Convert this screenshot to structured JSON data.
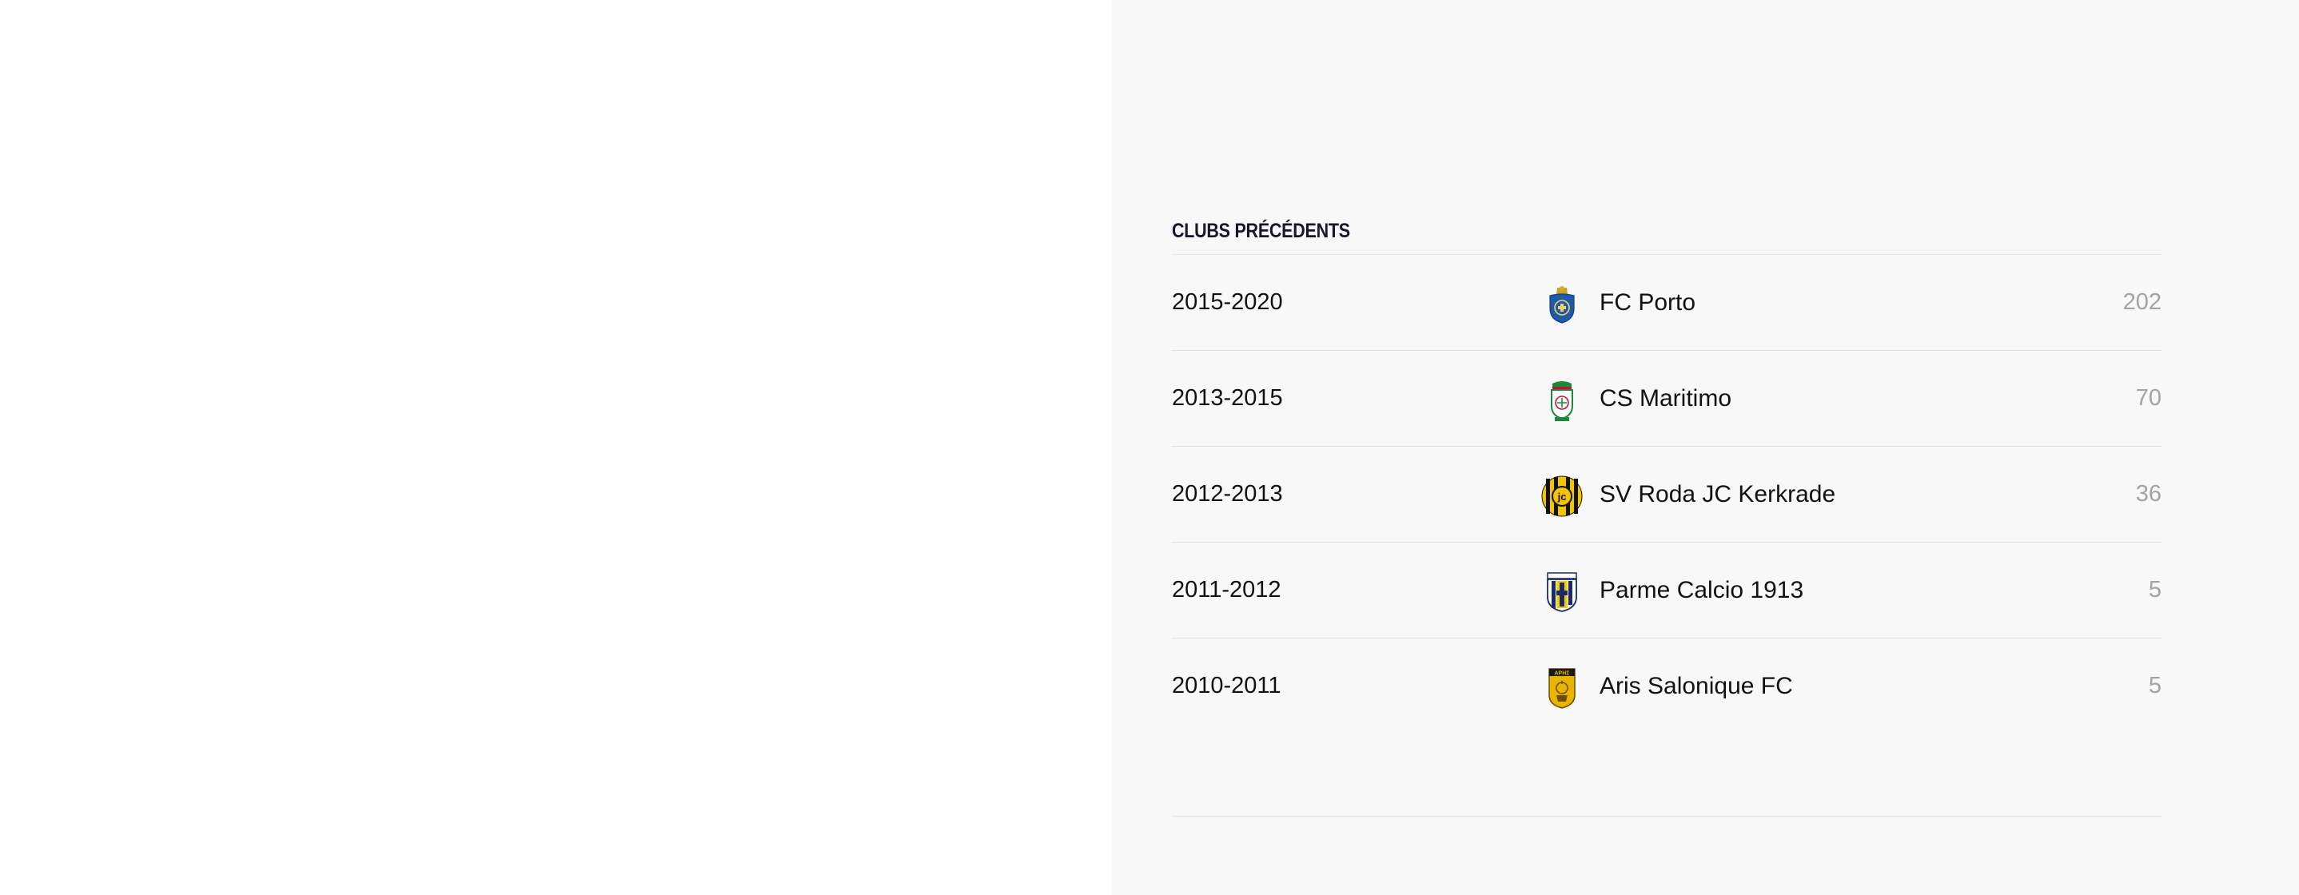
{
  "section": {
    "title": "CLUBS PRÉCÉDENTS"
  },
  "clubs": [
    {
      "years": "2015-2020",
      "name": "FC Porto",
      "apps": "202",
      "crest_icon": "fc-porto-crest-icon"
    },
    {
      "years": "2013-2015",
      "name": "CS Maritimo",
      "apps": "70",
      "crest_icon": "cs-maritimo-crest-icon"
    },
    {
      "years": "2012-2013",
      "name": "SV Roda JC Kerkrade",
      "apps": "36",
      "crest_icon": "roda-jc-crest-icon"
    },
    {
      "years": "2011-2012",
      "name": "Parme Calcio 1913",
      "apps": "5",
      "crest_icon": "parma-crest-icon"
    },
    {
      "years": "2010-2011",
      "name": "Aris Salonique FC",
      "apps": "5",
      "crest_icon": "aris-crest-icon"
    }
  ],
  "colors": {
    "left_background": "#ffffff",
    "right_background": "#f8f8f8",
    "text_primary": "#111111",
    "text_muted": "#a3a3a3",
    "divider": "#e4e4e4",
    "porto_blue": "#1f5aa8",
    "maritimo_green": "#1b8a3c",
    "roda_yellow": "#f2c500",
    "parma_yellow": "#f4d100",
    "aris_yellow": "#e8b400"
  }
}
